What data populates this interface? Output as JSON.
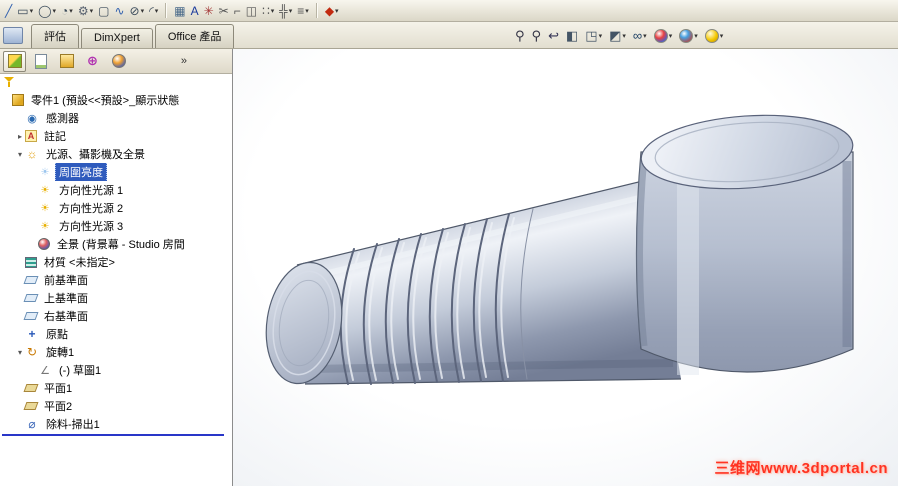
{
  "glyphs": {
    "dropdown": "▾",
    "arrow_collapsed": "▸",
    "arrow_expanded": "▾",
    "chevron": "»"
  },
  "command_tabs": [
    {
      "name": "tab-evaluate",
      "label": "評估"
    },
    {
      "name": "tab-dimxpert",
      "label": "DimXpert"
    },
    {
      "name": "tab-office-products",
      "label": "Office 產品"
    }
  ],
  "top_toolbar": {
    "icons": [
      {
        "name": "line-tool",
        "glyph": "╱",
        "color": "#2f5fae"
      },
      {
        "name": "rectangle-tool",
        "glyph": "▭",
        "color": "#3a4a5a",
        "dd": true
      },
      {
        "name": "circle-tool",
        "glyph": "◯",
        "color": "#3a4a5a",
        "dd": true
      },
      {
        "name": "arc-tool",
        "glyph": "◔",
        "color": "#3a4a5a",
        "dd": true
      },
      {
        "name": "polygon-tool",
        "glyph": "⚙",
        "color": "#56606e",
        "dd": true
      },
      {
        "name": "slot-tool",
        "glyph": "▢",
        "color": "#3a4a5a"
      },
      {
        "name": "spline-tool",
        "glyph": "∿",
        "color": "#2f5fae"
      },
      {
        "name": "ellipse-tool",
        "glyph": "⊘",
        "color": "#3a4a5a",
        "dd": true
      },
      {
        "name": "sketch-fillet-tool",
        "glyph": "◜",
        "color": "#3a4a5a",
        "dd": true
      },
      {
        "sep": true
      },
      {
        "name": "sketch-picture-tool",
        "glyph": "▦",
        "color": "#4a6a8a"
      },
      {
        "name": "text-tool",
        "glyph": "A",
        "color": "#1a3a9c"
      },
      {
        "name": "point-tool",
        "glyph": "✳",
        "color": "#a33636"
      },
      {
        "name": "trim-entities-tool",
        "glyph": "✂",
        "color": "#555555"
      },
      {
        "name": "convert-entities-tool",
        "glyph": "⌐",
        "color": "#555555"
      },
      {
        "name": "mirror-entities-tool",
        "glyph": "◫",
        "color": "#555555"
      },
      {
        "name": "linear-sketch-pattern-tool",
        "glyph": "∷",
        "color": "#555555",
        "dd": true
      },
      {
        "name": "move-entities-tool",
        "glyph": "╬",
        "color": "#555555",
        "dd": true
      },
      {
        "name": "offset-entities-tool",
        "glyph": "≡",
        "color": "#555555",
        "dd": true
      },
      {
        "sep": true
      },
      {
        "name": "make-block-tool",
        "glyph": "◆",
        "color": "#c22a10",
        "dd": true
      }
    ]
  },
  "hud_toolbar": {
    "icons": [
      {
        "name": "zoom-to-fit-icon",
        "glyph": "⚲",
        "color": "#333344"
      },
      {
        "name": "zoom-to-area-icon",
        "glyph": "⚲",
        "color": "#333344"
      },
      {
        "name": "previous-view-icon",
        "glyph": "↩",
        "color": "#333355"
      },
      {
        "name": "section-view-icon",
        "glyph": "◧",
        "color": "#445566"
      },
      {
        "name": "view-orientation-icon",
        "glyph": "◳",
        "color": "#445566",
        "dd": true
      },
      {
        "name": "display-style-icon",
        "glyph": "◩",
        "color": "#445566",
        "dd": true
      },
      {
        "name": "hide-show-items-icon",
        "glyph": "∞",
        "color": "#224466",
        "dd": true
      },
      {
        "name": "edit-appearance-icon",
        "ball": "appearance",
        "dd": true
      },
      {
        "name": "apply-scene-icon",
        "ball": "scene",
        "dd": true
      },
      {
        "name": "view-settings-icon",
        "ball": "light",
        "dd": true
      }
    ]
  },
  "manager_tabs": [
    {
      "name": "featuremanager-tab",
      "style": "fm"
    },
    {
      "name": "propertymanager-tab",
      "style": "pm"
    },
    {
      "name": "configurationmanager-tab",
      "style": "cm"
    },
    {
      "name": "dimxpertmanager-tab",
      "style": "dm",
      "glyph": "⊕",
      "color": "#b030b0"
    },
    {
      "name": "displaymanager-tab",
      "style": "sm"
    }
  ],
  "icon_glyphs": {
    "part": "",
    "sensor": "◉",
    "annotation": "A",
    "lights": "☼",
    "ambient": "☀",
    "dirlight": "☀",
    "scene": "",
    "material": "",
    "plane-ref": "",
    "origin": "+",
    "revolve": "↻",
    "sketch": "∠",
    "plane-feat": "",
    "cut-sweep": "⌀"
  },
  "tree": {
    "items": [
      {
        "id": "part",
        "level": 0,
        "arrow": null,
        "icon": "part",
        "label": "零件1 (預設<<預設>_顯示狀態"
      },
      {
        "id": "sensors",
        "level": 1,
        "arrow": null,
        "icon": "sensor",
        "label": "感測器"
      },
      {
        "id": "annotations",
        "level": 1,
        "arrow": "c",
        "icon": "annotation",
        "label": "註記"
      },
      {
        "id": "lights-folder",
        "level": 1,
        "arrow": "e",
        "icon": "lights",
        "label": "光源、攝影機及全景"
      },
      {
        "id": "ambient-light",
        "level": 2,
        "arrow": null,
        "icon": "ambient",
        "label": "周圍亮度",
        "selected": true
      },
      {
        "id": "directional-light-1",
        "level": 2,
        "arrow": null,
        "icon": "dirlight",
        "label": "方向性光源 1"
      },
      {
        "id": "directional-light-2",
        "level": 2,
        "arrow": null,
        "icon": "dirlight",
        "label": "方向性光源 2"
      },
      {
        "id": "directional-light-3",
        "level": 2,
        "arrow": null,
        "icon": "dirlight",
        "label": "方向性光源 3"
      },
      {
        "id": "scene",
        "level": 2,
        "arrow": null,
        "icon": "scene",
        "label": "全景 (背景幕 - Studio 房間"
      },
      {
        "id": "material",
        "level": 1,
        "arrow": null,
        "icon": "material",
        "label": "材質 <未指定>"
      },
      {
        "id": "front-plane",
        "level": 1,
        "arrow": null,
        "icon": "plane-ref",
        "label": "前基準面"
      },
      {
        "id": "top-plane",
        "level": 1,
        "arrow": null,
        "icon": "plane-ref",
        "label": "上基準面"
      },
      {
        "id": "right-plane",
        "level": 1,
        "arrow": null,
        "icon": "plane-ref",
        "label": "右基準面"
      },
      {
        "id": "origin",
        "level": 1,
        "arrow": null,
        "icon": "origin",
        "label": "原點"
      },
      {
        "id": "revolve1",
        "level": 1,
        "arrow": "e",
        "icon": "revolve",
        "label": "旋轉1"
      },
      {
        "id": "sketch1",
        "level": 2,
        "arrow": null,
        "icon": "sketch",
        "label": "(-) 草圖1"
      },
      {
        "id": "plane1",
        "level": 1,
        "arrow": null,
        "icon": "plane-feat",
        "label": "平面1"
      },
      {
        "id": "plane2",
        "level": 1,
        "arrow": null,
        "icon": "plane-feat",
        "label": "平面2"
      },
      {
        "id": "cut-sweep1",
        "level": 1,
        "arrow": null,
        "icon": "cut-sweep",
        "label": "除料-掃出1"
      }
    ]
  },
  "watermark": {
    "text": "三维网www.3dportal.cn",
    "color": "#ff3322"
  },
  "colors": {
    "selection": "#2f5bbd",
    "rollback_bar": "#2936c8",
    "toolbar_bg": "#ece9d8",
    "viewport_bg": "#f4f6f9"
  }
}
